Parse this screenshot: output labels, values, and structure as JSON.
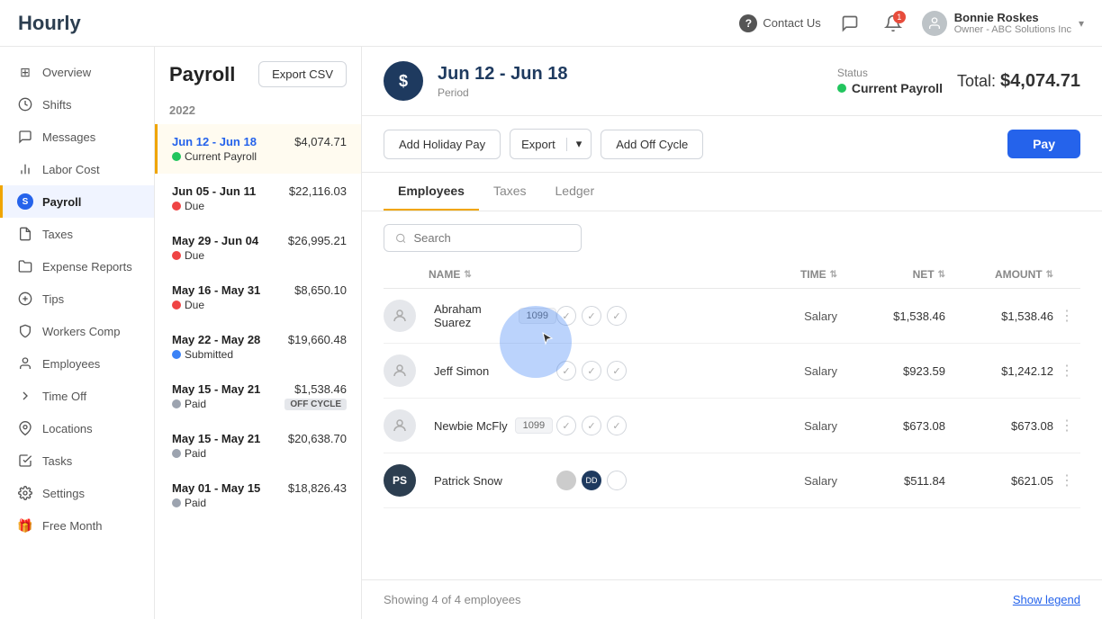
{
  "app": {
    "logo": "Hourly"
  },
  "topnav": {
    "contact_label": "Contact Us",
    "notification_count": "1",
    "user_name": "Bonnie Roskes",
    "user_role": "Owner - ABC Solutions Inc",
    "chevron": "▾"
  },
  "sidebar": {
    "items": [
      {
        "id": "overview",
        "label": "Overview",
        "icon": "⊞"
      },
      {
        "id": "shifts",
        "label": "Shifts",
        "icon": "⏱"
      },
      {
        "id": "messages",
        "label": "Messages",
        "icon": "✉"
      },
      {
        "id": "labor-cost",
        "label": "Labor Cost",
        "icon": "📊"
      },
      {
        "id": "payroll",
        "label": "Payroll",
        "icon": "S",
        "active": true
      },
      {
        "id": "taxes",
        "label": "Taxes",
        "icon": "📋"
      },
      {
        "id": "expense-reports",
        "label": "Expense Reports",
        "icon": "📁"
      },
      {
        "id": "tips",
        "label": "Tips",
        "icon": "💡"
      },
      {
        "id": "workers-comp",
        "label": "Workers Comp",
        "icon": "🛡"
      },
      {
        "id": "employees",
        "label": "Employees",
        "icon": "👤"
      },
      {
        "id": "time-off",
        "label": "Time Off",
        "icon": "➤"
      },
      {
        "id": "locations",
        "label": "Locations",
        "icon": "📍"
      },
      {
        "id": "tasks",
        "label": "Tasks",
        "icon": "✓"
      },
      {
        "id": "settings",
        "label": "Settings",
        "icon": "⚙"
      },
      {
        "id": "free-month",
        "label": "Free Month",
        "icon": "🎁"
      }
    ]
  },
  "payroll_list": {
    "year": "2022",
    "items": [
      {
        "period": "Jun 12 - Jun 18",
        "amount": "$4,074.71",
        "status": "Current Payroll",
        "status_type": "green",
        "active": true
      },
      {
        "period": "Jun 05 - Jun 11",
        "amount": "$22,116.03",
        "status": "Due",
        "status_type": "red"
      },
      {
        "period": "May 29 - Jun 04",
        "amount": "$26,995.21",
        "status": "Due",
        "status_type": "red"
      },
      {
        "period": "May 16 - May 31",
        "amount": "$8,650.10",
        "status": "Due",
        "status_type": "red"
      },
      {
        "period": "May 22 - May 28",
        "amount": "$19,660.48",
        "status": "Submitted",
        "status_type": "blue"
      },
      {
        "period": "May 15 - May 21",
        "amount": "$1,538.46",
        "status": "Paid",
        "status_type": "gray",
        "off_cycle": true
      },
      {
        "period": "May 15 - May 21",
        "amount": "$20,638.70",
        "status": "Paid",
        "status_type": "gray"
      },
      {
        "period": "May 01 - May 15",
        "amount": "$18,826.43",
        "status": "Paid",
        "status_type": "gray"
      }
    ]
  },
  "payroll_detail": {
    "page_title": "Payroll",
    "export_csv": "Export CSV",
    "period": "Jun 12 - Jun 18",
    "period_label": "Period",
    "status": "Current Payroll",
    "status_label": "Status",
    "total_label": "Total:",
    "total_amount": "$4,074.71",
    "icon_letter": "$",
    "buttons": {
      "add_holiday": "Add Holiday Pay",
      "export": "Export",
      "add_off_cycle": "Add Off Cycle",
      "pay": "Pay"
    },
    "tabs": [
      {
        "id": "employees",
        "label": "Employees",
        "active": true
      },
      {
        "id": "taxes",
        "label": "Taxes"
      },
      {
        "id": "ledger",
        "label": "Ledger"
      }
    ],
    "search_placeholder": "Search",
    "table": {
      "headers": {
        "name": "NAME",
        "time": "TIME",
        "net": "NET",
        "amount": "AMOUNT"
      },
      "employees": [
        {
          "name": "Abraham Suarez",
          "badge": "1099",
          "type": "Salary",
          "net": "$1,538.46",
          "amount": "$1,538.46",
          "avatar_initials": "",
          "has_avatar": false
        },
        {
          "name": "Jeff Simon",
          "badge": "",
          "type": "Salary",
          "net": "$923.59",
          "amount": "$1,242.12",
          "avatar_initials": "",
          "has_avatar": false
        },
        {
          "name": "Newbie McFly",
          "badge": "1099",
          "type": "Salary",
          "net": "$673.08",
          "amount": "$673.08",
          "avatar_initials": "",
          "has_avatar": false
        },
        {
          "name": "Patrick Snow",
          "badge": "",
          "type": "Salary",
          "net": "$511.84",
          "amount": "$621.05",
          "avatar_initials": "PS",
          "has_avatar": true
        }
      ]
    },
    "footer": {
      "showing": "Showing 4 of 4 employees",
      "show_legend": "Show legend"
    }
  }
}
